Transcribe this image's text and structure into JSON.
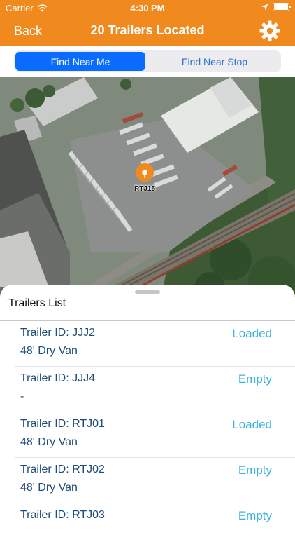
{
  "status_bar": {
    "carrier": "Carrier",
    "time": "4:30 PM"
  },
  "nav": {
    "back_label": "Back",
    "title": "20 Trailers Located",
    "settings_icon": "gear-icon"
  },
  "segmented": {
    "left_label": "Find Near Me",
    "right_label": "Find Near Stop"
  },
  "map": {
    "pin_label": "RTJ15",
    "pin_color": "#f08a1e"
  },
  "sheet": {
    "title": "Trailers List"
  },
  "trailers": [
    {
      "id": "Trailer ID: JJJ2",
      "type": "48' Dry Van",
      "status": "Loaded"
    },
    {
      "id": "Trailer ID: JJJ4",
      "type": "-",
      "status": "Empty"
    },
    {
      "id": "Trailer ID: RTJ01",
      "type": "48' Dry Van",
      "status": "Loaded"
    },
    {
      "id": "Trailer ID: RTJ02",
      "type": "48' Dry Van",
      "status": "Empty"
    },
    {
      "id": "Trailer ID: RTJ03",
      "type": "",
      "status": "Empty"
    }
  ],
  "colors": {
    "accent": "#f08a1e",
    "segment_selected": "#0a6cff",
    "status_text": "#3ab2e0",
    "id_text": "#1c4c79"
  }
}
